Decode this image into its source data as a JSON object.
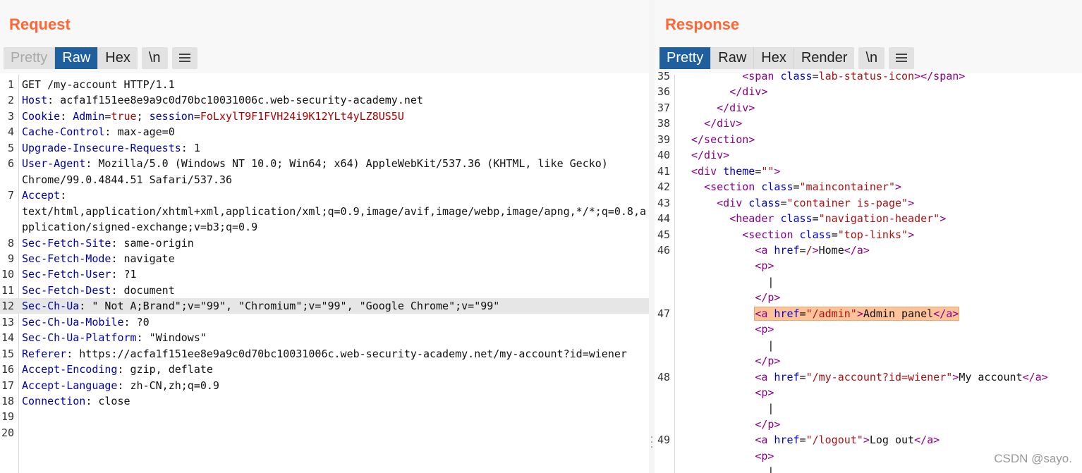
{
  "request": {
    "title": "Request",
    "tabs": [
      "Pretty",
      "Raw",
      "Hex"
    ],
    "newline_btn": "\\n",
    "menu_icon": "hamburger-menu-icon",
    "lines": [
      {
        "n": "1",
        "parts": [
          {
            "c": "GET /my-account HTTP/1.1"
          }
        ]
      },
      {
        "n": "2",
        "parts": [
          {
            "c": "Host",
            "k": "k"
          },
          {
            "c": ": acfa1f151ee8e9a9c0d70bc10031006c.web-security-academy.net"
          }
        ]
      },
      {
        "n": "3",
        "parts": [
          {
            "c": "Cookie",
            "k": "k"
          },
          {
            "c": ": "
          },
          {
            "c": "Admin",
            "k": "k"
          },
          {
            "c": "="
          },
          {
            "c": "true",
            "k": "v"
          },
          {
            "c": "; "
          },
          {
            "c": "session",
            "k": "k"
          },
          {
            "c": "="
          },
          {
            "c": "FoLxylT9F1FVH24i9K12YLt4yLZ8US5U",
            "k": "v"
          }
        ]
      },
      {
        "n": "4",
        "parts": [
          {
            "c": "Cache-Control",
            "k": "k"
          },
          {
            "c": ": max-age=0"
          }
        ]
      },
      {
        "n": "5",
        "parts": [
          {
            "c": "Upgrade-Insecure-Requests",
            "k": "k"
          },
          {
            "c": ": 1"
          }
        ]
      },
      {
        "n": "6",
        "parts": [
          {
            "c": "User-Agent",
            "k": "k"
          },
          {
            "c": ": Mozilla/5.0 (Windows NT 10.0; Win64; x64) AppleWebKit/537.36 (KHTML, like Gecko)"
          }
        ]
      },
      {
        "n": "",
        "parts": [
          {
            "c": "Chrome/99.0.4844.51 Safari/537.36"
          }
        ]
      },
      {
        "n": "7",
        "parts": [
          {
            "c": "Accept",
            "k": "k"
          },
          {
            "c": ":"
          }
        ]
      },
      {
        "n": "",
        "parts": [
          {
            "c": "text/html,application/xhtml+xml,application/xml;q=0.9,image/avif,image/webp,image/apng,*/*;q=0.8,a"
          }
        ]
      },
      {
        "n": "",
        "parts": [
          {
            "c": "pplication/signed-exchange;v=b3;q=0.9"
          }
        ]
      },
      {
        "n": "8",
        "parts": [
          {
            "c": "Sec-Fetch-Site",
            "k": "k"
          },
          {
            "c": ": same-origin"
          }
        ]
      },
      {
        "n": "9",
        "parts": [
          {
            "c": "Sec-Fetch-Mode",
            "k": "k"
          },
          {
            "c": ": navigate"
          }
        ]
      },
      {
        "n": "10",
        "parts": [
          {
            "c": "Sec-Fetch-User",
            "k": "k"
          },
          {
            "c": ": ?1"
          }
        ]
      },
      {
        "n": "11",
        "parts": [
          {
            "c": "Sec-Fetch-Dest",
            "k": "k"
          },
          {
            "c": ": document"
          }
        ]
      },
      {
        "n": "12",
        "hl": true,
        "parts": [
          {
            "c": "Sec-Ch-Ua",
            "k": "k"
          },
          {
            "c": ": \" Not A;Brand\";v=\"99\", \"Chromium\";v=\"99\", \"Google Chrome\";v=\"99\""
          }
        ]
      },
      {
        "n": "13",
        "parts": [
          {
            "c": "Sec-Ch-Ua-Mobile",
            "k": "k"
          },
          {
            "c": ": ?0"
          }
        ]
      },
      {
        "n": "14",
        "parts": [
          {
            "c": "Sec-Ch-Ua-Platform",
            "k": "k"
          },
          {
            "c": ": \"Windows\""
          }
        ]
      },
      {
        "n": "15",
        "parts": [
          {
            "c": "Referer",
            "k": "k"
          },
          {
            "c": ": https://acfa1f151ee8e9a9c0d70bc10031006c.web-security-academy.net/my-account?id=wiener"
          }
        ]
      },
      {
        "n": "16",
        "parts": [
          {
            "c": "Accept-Encoding",
            "k": "k"
          },
          {
            "c": ": gzip, deflate"
          }
        ]
      },
      {
        "n": "17",
        "parts": [
          {
            "c": "Accept-Language",
            "k": "k"
          },
          {
            "c": ": zh-CN,zh;q=0.9"
          }
        ]
      },
      {
        "n": "18",
        "parts": [
          {
            "c": "Connection",
            "k": "k"
          },
          {
            "c": ": close"
          }
        ]
      },
      {
        "n": "19",
        "parts": []
      },
      {
        "n": "20",
        "parts": []
      }
    ]
  },
  "response": {
    "title": "Response",
    "tabs": [
      "Pretty",
      "Raw",
      "Hex",
      "Render"
    ],
    "newline_btn": "\\n",
    "menu_icon": "hamburger-menu-icon",
    "lines": [
      {
        "n": "35",
        "parts": [
          {
            "c": "        "
          },
          {
            "c": "<span",
            "k": "t"
          },
          {
            "c": " "
          },
          {
            "c": "class",
            "k": "a"
          },
          {
            "c": "="
          },
          {
            "c": "lab-status-icon",
            "k": "s"
          },
          {
            "c": ">",
            "k": "t"
          },
          {
            "c": "</span>",
            "k": "t"
          }
        ]
      },
      {
        "n": "36",
        "parts": [
          {
            "c": "      "
          },
          {
            "c": "</div>",
            "k": "t"
          }
        ]
      },
      {
        "n": "37",
        "parts": [
          {
            "c": "    "
          },
          {
            "c": "</div>",
            "k": "t"
          }
        ]
      },
      {
        "n": "38",
        "parts": [
          {
            "c": "  "
          },
          {
            "c": "</div>",
            "k": "t"
          }
        ]
      },
      {
        "n": "39",
        "parts": [
          {
            "c": "</section>",
            "k": "t"
          }
        ]
      },
      {
        "n": "40",
        "parts": [
          {
            "c": "</div>",
            "k": "t"
          }
        ]
      },
      {
        "n": "41",
        "parts": [
          {
            "c": "<div",
            "k": "t"
          },
          {
            "c": " "
          },
          {
            "c": "theme",
            "k": "a"
          },
          {
            "c": "="
          },
          {
            "c": "\"\"",
            "k": "s"
          },
          {
            "c": ">",
            "k": "t"
          }
        ]
      },
      {
        "n": "42",
        "parts": [
          {
            "c": "  "
          },
          {
            "c": "<section",
            "k": "t"
          },
          {
            "c": " "
          },
          {
            "c": "class",
            "k": "a"
          },
          {
            "c": "="
          },
          {
            "c": "\"maincontainer\"",
            "k": "s"
          },
          {
            "c": ">",
            "k": "t"
          }
        ]
      },
      {
        "n": "43",
        "parts": [
          {
            "c": "    "
          },
          {
            "c": "<div",
            "k": "t"
          },
          {
            "c": " "
          },
          {
            "c": "class",
            "k": "a"
          },
          {
            "c": "="
          },
          {
            "c": "\"container is-page\"",
            "k": "s"
          },
          {
            "c": ">",
            "k": "t"
          }
        ]
      },
      {
        "n": "44",
        "parts": [
          {
            "c": "      "
          },
          {
            "c": "<header",
            "k": "t"
          },
          {
            "c": " "
          },
          {
            "c": "class",
            "k": "a"
          },
          {
            "c": "="
          },
          {
            "c": "\"navigation-header\"",
            "k": "s"
          },
          {
            "c": ">",
            "k": "t"
          }
        ]
      },
      {
        "n": "45",
        "parts": [
          {
            "c": "        "
          },
          {
            "c": "<section",
            "k": "t"
          },
          {
            "c": " "
          },
          {
            "c": "class",
            "k": "a"
          },
          {
            "c": "="
          },
          {
            "c": "\"top-links\"",
            "k": "s"
          },
          {
            "c": ">",
            "k": "t"
          }
        ]
      },
      {
        "n": "46",
        "parts": [
          {
            "c": "          "
          },
          {
            "c": "<a",
            "k": "t"
          },
          {
            "c": " "
          },
          {
            "c": "href",
            "k": "a"
          },
          {
            "c": "="
          },
          {
            "c": "/",
            "k": "s"
          },
          {
            "c": ">",
            "k": "t"
          },
          {
            "c": "Home"
          },
          {
            "c": "</a>",
            "k": "t"
          }
        ]
      },
      {
        "n": "",
        "parts": [
          {
            "c": "          "
          },
          {
            "c": "<p>",
            "k": "t"
          }
        ]
      },
      {
        "n": "",
        "parts": [
          {
            "c": "            |"
          }
        ]
      },
      {
        "n": "",
        "parts": [
          {
            "c": "          "
          },
          {
            "c": "</p>",
            "k": "t"
          }
        ]
      },
      {
        "n": "47",
        "match": true,
        "parts": [
          {
            "c": "          "
          },
          {
            "c": "<a",
            "k": "t"
          },
          {
            "c": " "
          },
          {
            "c": "href",
            "k": "a"
          },
          {
            "c": "="
          },
          {
            "c": "\"/admin\"",
            "k": "s"
          },
          {
            "c": ">",
            "k": "t"
          },
          {
            "c": "Admin panel"
          },
          {
            "c": "</a>",
            "k": "t"
          }
        ]
      },
      {
        "n": "",
        "parts": [
          {
            "c": "          "
          },
          {
            "c": "<p>",
            "k": "t"
          }
        ]
      },
      {
        "n": "",
        "parts": [
          {
            "c": "            |"
          }
        ]
      },
      {
        "n": "",
        "parts": [
          {
            "c": "          "
          },
          {
            "c": "</p>",
            "k": "t"
          }
        ]
      },
      {
        "n": "48",
        "parts": [
          {
            "c": "          "
          },
          {
            "c": "<a",
            "k": "t"
          },
          {
            "c": " "
          },
          {
            "c": "href",
            "k": "a"
          },
          {
            "c": "="
          },
          {
            "c": "\"/my-account?id=wiener\"",
            "k": "s"
          },
          {
            "c": ">",
            "k": "t"
          },
          {
            "c": "My account"
          },
          {
            "c": "</a>",
            "k": "t"
          }
        ]
      },
      {
        "n": "",
        "parts": [
          {
            "c": "          "
          },
          {
            "c": "<p>",
            "k": "t"
          }
        ]
      },
      {
        "n": "",
        "parts": [
          {
            "c": "            |"
          }
        ]
      },
      {
        "n": "",
        "parts": [
          {
            "c": "          "
          },
          {
            "c": "</p>",
            "k": "t"
          }
        ]
      },
      {
        "n": "49",
        "parts": [
          {
            "c": "          "
          },
          {
            "c": "<a",
            "k": "t"
          },
          {
            "c": " "
          },
          {
            "c": "href",
            "k": "a"
          },
          {
            "c": "="
          },
          {
            "c": "\"/logout\"",
            "k": "s"
          },
          {
            "c": ">",
            "k": "t"
          },
          {
            "c": "Log out"
          },
          {
            "c": "</a>",
            "k": "t"
          }
        ]
      },
      {
        "n": "",
        "parts": [
          {
            "c": "          "
          },
          {
            "c": "<p>",
            "k": "t"
          }
        ]
      },
      {
        "n": "",
        "parts": [
          {
            "c": "            |"
          }
        ]
      }
    ]
  },
  "watermark": "CSDN @sayo."
}
